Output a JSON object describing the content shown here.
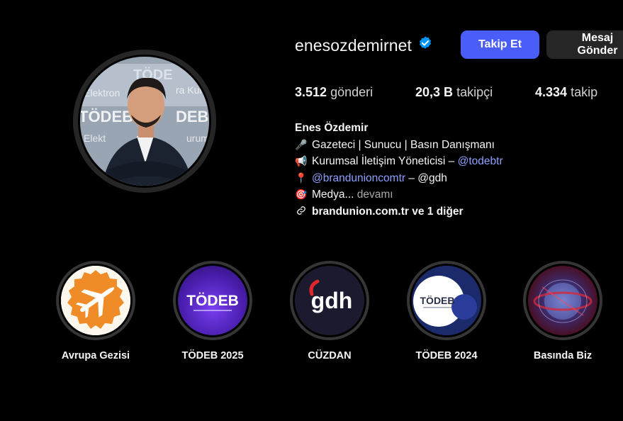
{
  "profile": {
    "username": "enesozdemirnet",
    "verified": true,
    "follow_label": "Takip Et",
    "message_label": "Mesaj Gönder"
  },
  "stats": [
    {
      "value": "3.512",
      "label": "gönderi"
    },
    {
      "value": "20,3 B",
      "label": "takipçi"
    },
    {
      "value": "4.334",
      "label": "takip"
    }
  ],
  "bio": {
    "name": "Enes Özdemir",
    "line1": "Gazeteci | Sunucu | Basın Danışmanı",
    "line2_text": "Kurumsal İletişim Yöneticisi – ",
    "line2_link": "@todebtr",
    "line3_link": "@brandunioncomtr",
    "line3_text": " – @gdh",
    "line4_text": "Medya...",
    "line4_more": "devamı",
    "link_text": "brandunion.com.tr ve 1 diğer"
  },
  "highlights": [
    {
      "label": "Avrupa Gezisi",
      "icon": "airplane-icon"
    },
    {
      "label": "TÖDEB 2025",
      "logo_text": "TÖDEB"
    },
    {
      "label": "CÜZDAN",
      "logo_text": "gdh"
    },
    {
      "label": "TÖDEB 2024",
      "logo_text": "TÖDEB"
    },
    {
      "label": "Basında Biz"
    }
  ],
  "colors": {
    "background": "#000000",
    "accent": "#4a5df9",
    "link": "#8ea0ff",
    "verified": "#0095f6"
  }
}
